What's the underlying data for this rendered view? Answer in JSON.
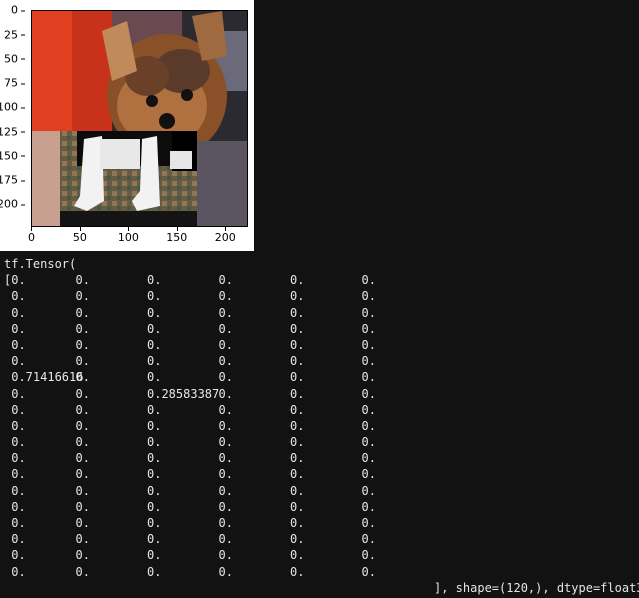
{
  "plot": {
    "yticks": [
      "0",
      "25",
      "50",
      "75",
      "100",
      "125",
      "150",
      "175",
      "200"
    ],
    "xticks": [
      "0",
      "50",
      "100",
      "150",
      "200"
    ],
    "image_description": "yorkshire-terrier-photo-with-pasted-patch"
  },
  "console": {
    "header": "tf.Tensor(",
    "rows": [
      [
        "[0.",
        "0.",
        "0.",
        "0.",
        "0.",
        "0."
      ],
      [
        " 0.",
        "0.",
        "0.",
        "0.",
        "0.",
        "0."
      ],
      [
        " 0.",
        "0.",
        "0.",
        "0.",
        "0.",
        "0."
      ],
      [
        " 0.",
        "0.",
        "0.",
        "0.",
        "0.",
        "0."
      ],
      [
        " 0.",
        "0.",
        "0.",
        "0.",
        "0.",
        "0."
      ],
      [
        " 0.",
        "0.",
        "0.",
        "0.",
        "0.",
        "0."
      ],
      [
        " 0.71416616",
        "0.",
        "0.",
        "0.",
        "0.",
        "0."
      ],
      [
        " 0.",
        "0.",
        "0.28583387",
        "0.",
        "0.",
        "0."
      ],
      [
        " 0.",
        "0.",
        "0.",
        "0.",
        "0.",
        "0."
      ],
      [
        " 0.",
        "0.",
        "0.",
        "0.",
        "0.",
        "0."
      ],
      [
        " 0.",
        "0.",
        "0.",
        "0.",
        "0.",
        "0."
      ],
      [
        " 0.",
        "0.",
        "0.",
        "0.",
        "0.",
        "0."
      ],
      [
        " 0.",
        "0.",
        "0.",
        "0.",
        "0.",
        "0."
      ],
      [
        " 0.",
        "0.",
        "0.",
        "0.",
        "0.",
        "0."
      ],
      [
        " 0.",
        "0.",
        "0.",
        "0.",
        "0.",
        "0."
      ],
      [
        " 0.",
        "0.",
        "0.",
        "0.",
        "0.",
        "0."
      ],
      [
        " 0.",
        "0.",
        "0.",
        "0.",
        "0.",
        "0."
      ],
      [
        " 0.",
        "0.",
        "0.",
        "0.",
        "0.",
        "0."
      ],
      [
        " 0.",
        "0.",
        "0.",
        "0.",
        "0.",
        "0."
      ]
    ],
    "suffix": "], shape=(120,), dtype=float32)"
  }
}
